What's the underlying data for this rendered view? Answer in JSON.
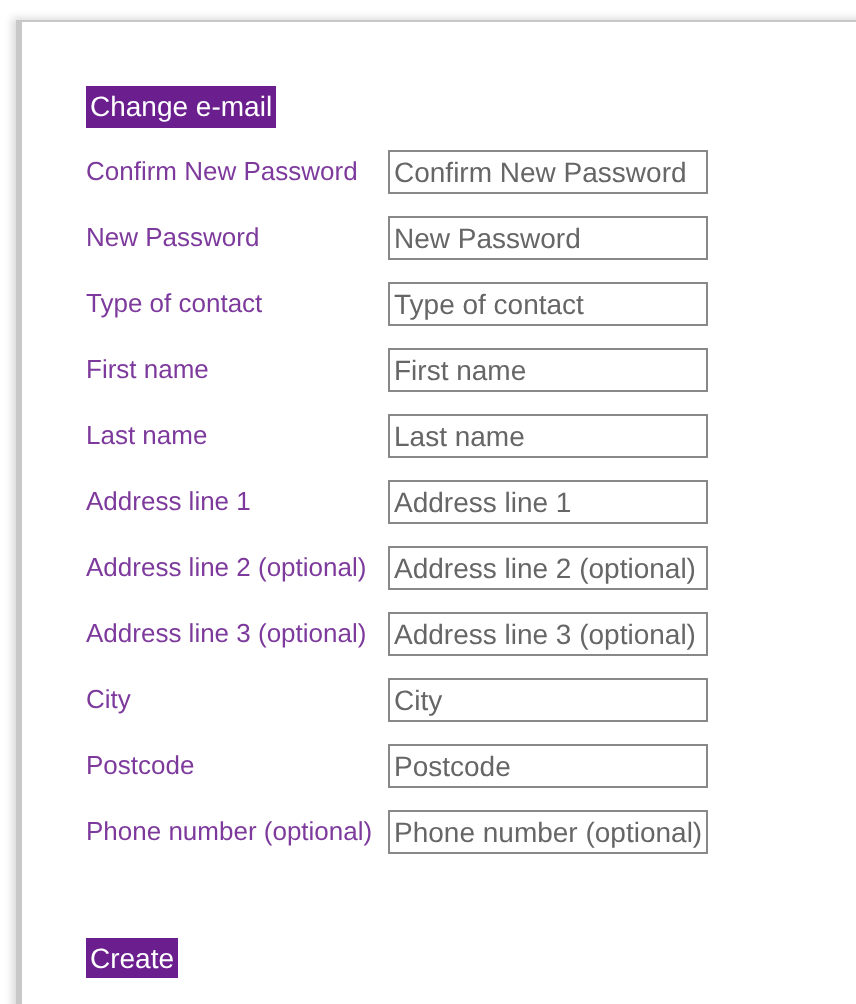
{
  "buttons_top": [
    {
      "label": "Change e-mail"
    }
  ],
  "fields": [
    {
      "label": "Confirm New Password",
      "placeholder": "Confirm New Password"
    },
    {
      "label": "New Password",
      "placeholder": "New Password"
    },
    {
      "label": "Type of contact",
      "placeholder": "Type of contact"
    },
    {
      "label": "First name",
      "placeholder": "First name"
    },
    {
      "label": "Last name",
      "placeholder": "Last name"
    },
    {
      "label": "Address line 1",
      "placeholder": "Address line 1"
    },
    {
      "label": "Address line 2 (optional)",
      "placeholder": "Address line 2 (optional)"
    },
    {
      "label": "Address line 3 (optional)",
      "placeholder": "Address line 3 (optional)"
    },
    {
      "label": "City",
      "placeholder": "City"
    },
    {
      "label": "Postcode",
      "placeholder": "Postcode"
    },
    {
      "label": "Phone number (optional)",
      "placeholder": "Phone number (optional)"
    }
  ],
  "submit": {
    "label": "Create"
  }
}
